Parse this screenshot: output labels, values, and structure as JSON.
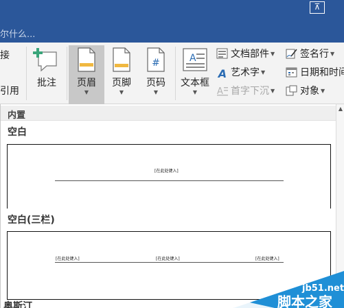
{
  "titlebar": {
    "search_hint": "尔什么...",
    "restore_icon": "ribbon-display-icon"
  },
  "ribbon": {
    "cut_left_top": "接",
    "cut_left_bottom": "引用",
    "comment": "批注",
    "header": "页眉",
    "footer": "页脚",
    "page_number": "页码",
    "textbox": "文本框",
    "quick_parts": "文档部件",
    "wordart": "艺术字",
    "drop_cap": "首字下沉",
    "signature_line": "签名行",
    "date_time": "日期和时间",
    "object": "对象"
  },
  "gallery": {
    "section_title": "内置",
    "items": [
      {
        "title": "空白",
        "placeholders": [
          "[在此处键入]"
        ]
      },
      {
        "title": "空白(三栏)",
        "placeholders": [
          "[在此处键入]",
          "[在此处键入]",
          "[在此处键入]"
        ]
      },
      {
        "title": "奥斯汀"
      }
    ]
  },
  "watermark": {
    "site": "jb51.net",
    "brand": "脚本之家"
  },
  "colors": {
    "title_bg": "#2b579a",
    "ribbon_bg": "#f3f3f3",
    "active_btn": "#c8c8c8",
    "accent_orange": "#f0b840",
    "watermark_blue": "#1f8fd6"
  }
}
